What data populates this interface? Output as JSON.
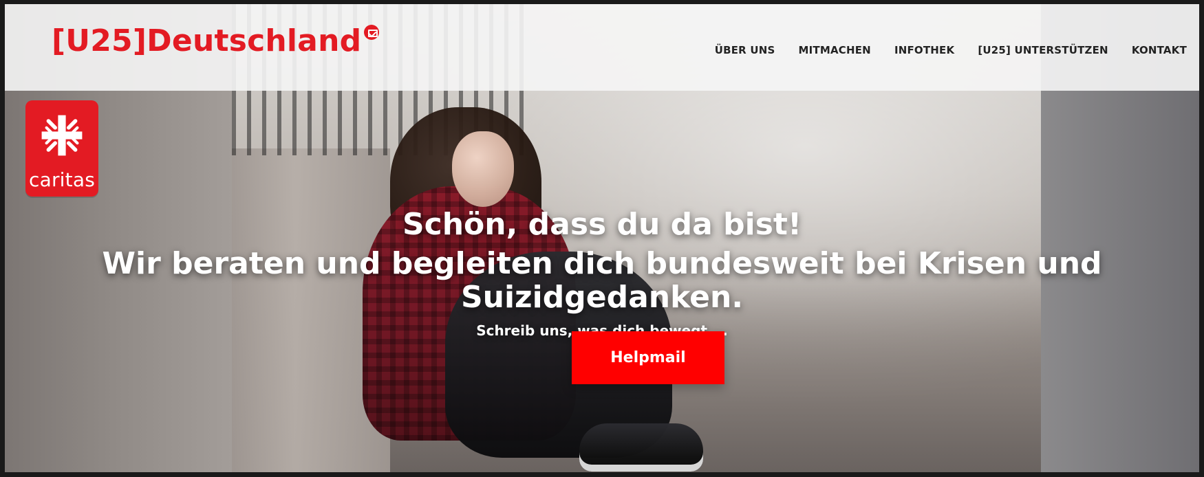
{
  "header": {
    "brand": "[U25]Deutschland",
    "nav": [
      {
        "label": "ÜBER UNS"
      },
      {
        "label": "MITMACHEN"
      },
      {
        "label": "INFOTHEK"
      },
      {
        "label": "[U25] UNTERSTÜTZEN"
      },
      {
        "label": "KONTAKT"
      }
    ]
  },
  "logo": {
    "caritas_word": "caritas"
  },
  "hero": {
    "headline": "Schön, dass du da bist!",
    "subheadline": "Wir beraten und begleiten dich bundesweit bei Krisen und Suizidgedanken.",
    "tagline": "Schreib uns, was dich bewegt ...",
    "cta_label": "Helpmail"
  },
  "colors": {
    "brand_red": "#e31b23",
    "cta_red": "#ff0000",
    "header_bg": "#f5f5f5"
  },
  "icons": {
    "brand_badge": "mail-icon",
    "caritas_symbol": "caritas-cross-icon"
  }
}
